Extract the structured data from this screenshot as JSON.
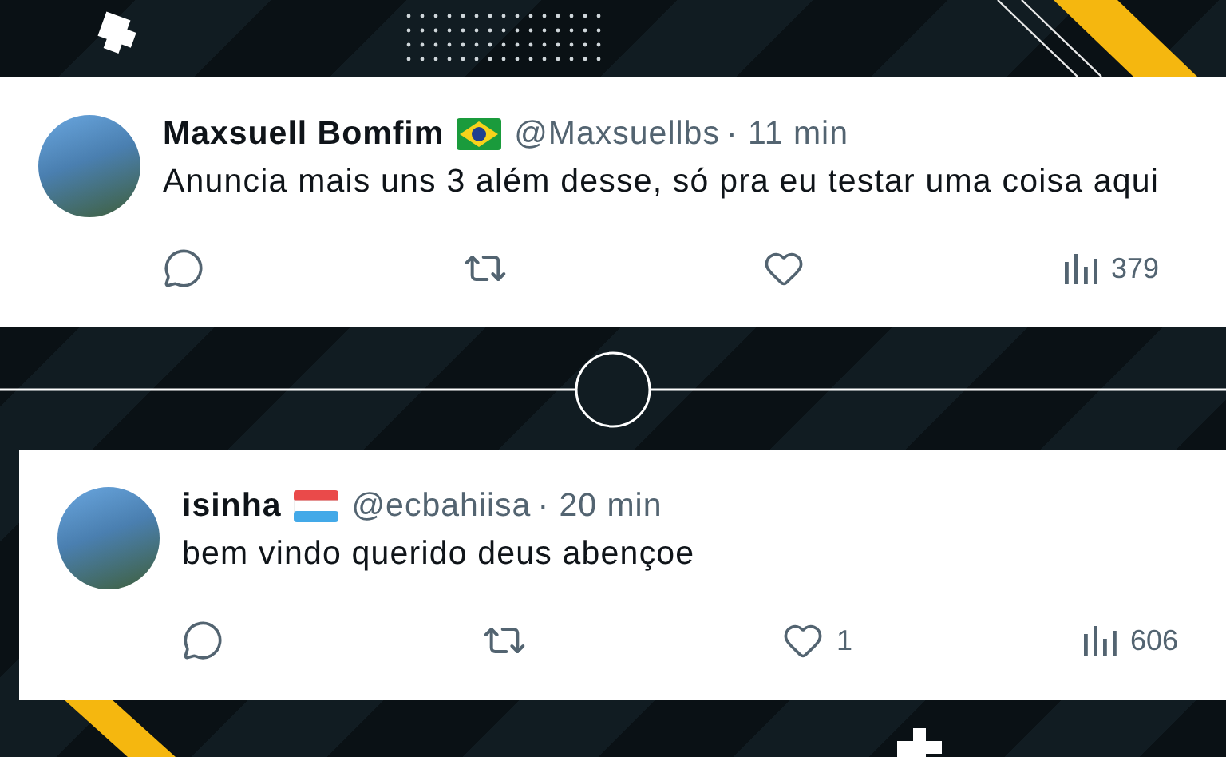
{
  "tweets": [
    {
      "name": "Maxsuell Bomfim",
      "kind": "green-diamond",
      "handle": "@Maxsuellbs",
      "time": "· 11 min",
      "text": "Anuncia mais uns 3 além desse, só pra eu testar uma coisa aqui",
      "views": "379"
    },
    {
      "name": "isinha",
      "kind": "striped",
      "handle": "@ecbahiisa",
      "time": "· 20 min",
      "text": "bem vindo querido deus abençoe",
      "likes": "1",
      "views": "606"
    }
  ]
}
